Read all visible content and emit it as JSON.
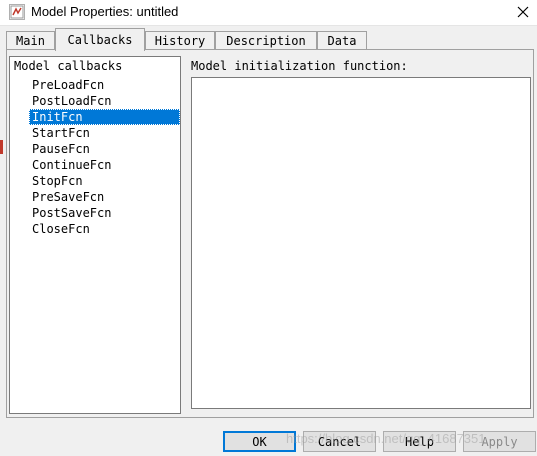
{
  "window": {
    "title": "Model Properties: untitled",
    "icon": "simulink-model-icon",
    "close_icon": "close-icon"
  },
  "tabs": [
    {
      "label": "Main",
      "active": false
    },
    {
      "label": "Callbacks",
      "active": true
    },
    {
      "label": "History",
      "active": false
    },
    {
      "label": "Description",
      "active": false
    },
    {
      "label": "Data",
      "active": false
    }
  ],
  "callbacks": {
    "header": "Model callbacks",
    "items": [
      "PreLoadFcn",
      "PostLoadFcn",
      "InitFcn",
      "StartFcn",
      "PauseFcn",
      "ContinueFcn",
      "StopFcn",
      "PreSaveFcn",
      "PostSaveFcn",
      "CloseFcn"
    ],
    "selected": "InitFcn"
  },
  "editor": {
    "label": "Model initialization function:",
    "value": ""
  },
  "buttons": {
    "ok": "OK",
    "cancel": "Cancel",
    "help": "Help",
    "apply": "Apply"
  },
  "watermark": "https://blog.csdn.net/qq_41687351",
  "colors": {
    "selection": "#0078d7",
    "default_button_border": "#0078d7"
  }
}
